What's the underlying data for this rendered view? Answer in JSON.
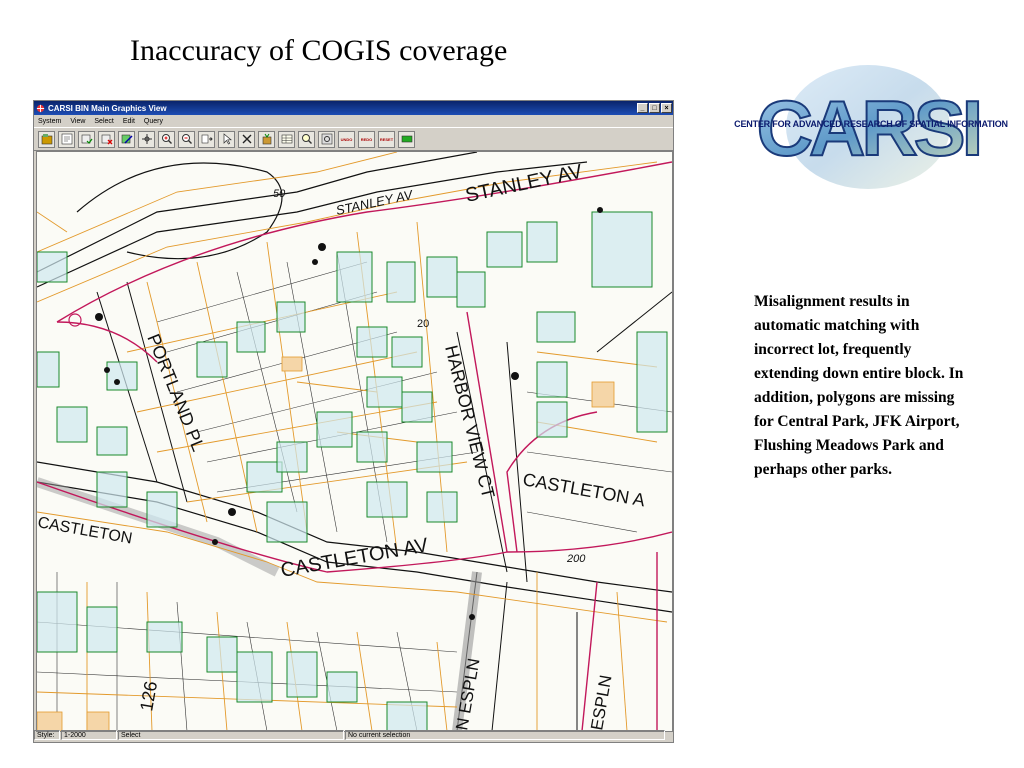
{
  "slide": {
    "title": "Inaccuracy of COGIS coverage",
    "description": "Misalignment results in automatic matching with incorrect lot, frequently extending down entire block.  In addition, polygons are missing for Central Park, JFK Airport, Flushing Meadows Park and perhaps other parks."
  },
  "window": {
    "title": "CARSI BIN Main Graphics View",
    "minimize": "_",
    "maximize": "□",
    "close": "×",
    "menu": [
      "System",
      "View",
      "Select",
      "Edit",
      "Query"
    ]
  },
  "toolbar": {
    "undo_label": "UNDO",
    "redo_label": "REDO",
    "reset_label": "RESET"
  },
  "map_labels": {
    "stanley_av": "STANLEY AV",
    "stanley_av_old": "STANLEY AV",
    "harbor_view": "HARBOR VIEW CT",
    "castleton_av": "CASTLETON AV",
    "castleton_a": "CASTLETON A",
    "castleton_left": "CASTLETON",
    "portland_pl": "PORTLAND PL",
    "espln": "ESPLN",
    "n_espln": "N ESPLN",
    "lot_126": "126",
    "lot_200": "200",
    "lot_20": "20",
    "lot_50": "50"
  },
  "status": {
    "style_label": "Style:",
    "style_value": "1-2000",
    "mode": "Select",
    "selection": "No current selection"
  },
  "logo": {
    "letters": "CARSI",
    "org_name": "CENTER FOR ADVANCED RESEARCH OF SPATIAL INFORMATION"
  }
}
